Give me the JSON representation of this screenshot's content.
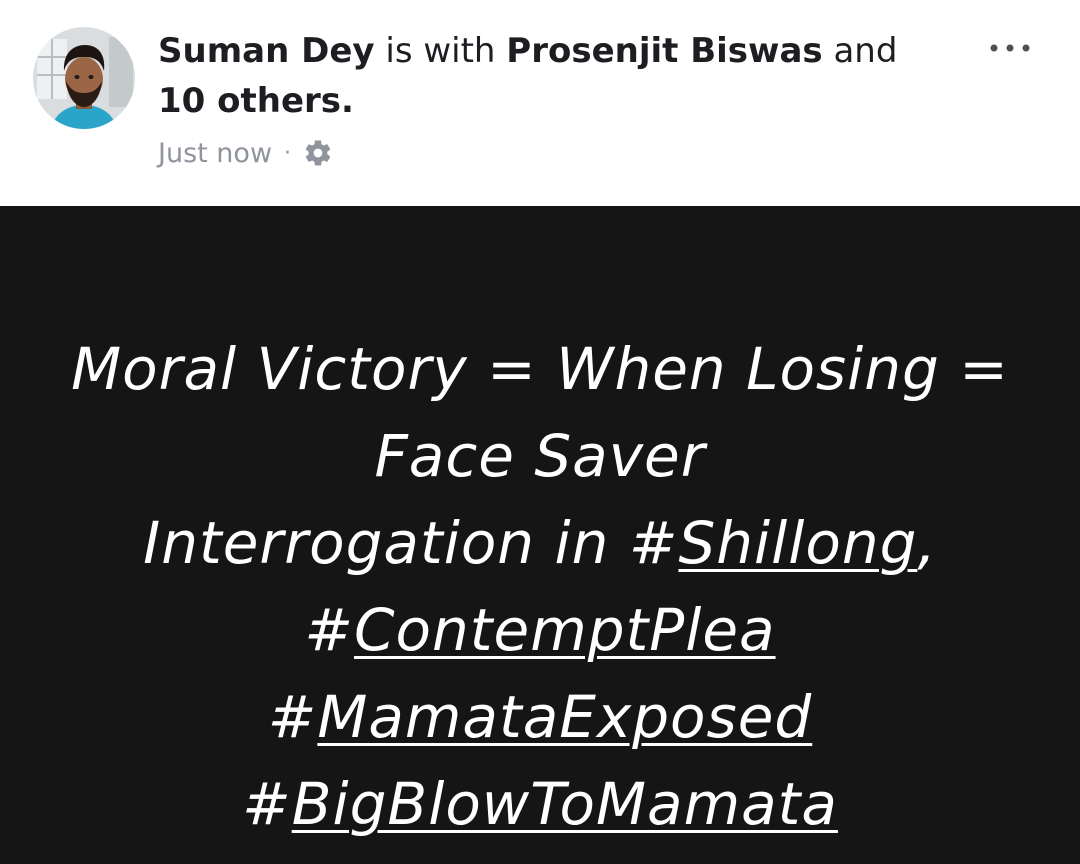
{
  "post": {
    "author": {
      "name": "Suman Dey",
      "with_text": "is with",
      "tagged_name": "Prosenjit Biswas",
      "and_text": "and",
      "others": "10 others",
      "end_punct": "."
    },
    "timestamp": "Just now",
    "separator": "·",
    "privacy_icon": "gear-icon",
    "menu_icon": "more-horizontal-icon",
    "more_label": "···",
    "content": {
      "line1": "Moral Victory = When Losing =",
      "line2": "Face Saver",
      "line3_prefix": "Interrogation in ",
      "line3_hash": "#",
      "line3_tag": "Shillong",
      "line3_suffix": ",",
      "line4_hash": "#",
      "line4_tag": "ContemptPlea",
      "line5_hash": "#",
      "line5_tag": "MamataExposed",
      "line6_hash": "#",
      "line6_tag": "BigBlowToMamata"
    },
    "colors": {
      "background_dark": "#151515",
      "text_light": "#ffffff",
      "meta_gray": "#90949c",
      "name_dark": "#1c1e21"
    }
  }
}
